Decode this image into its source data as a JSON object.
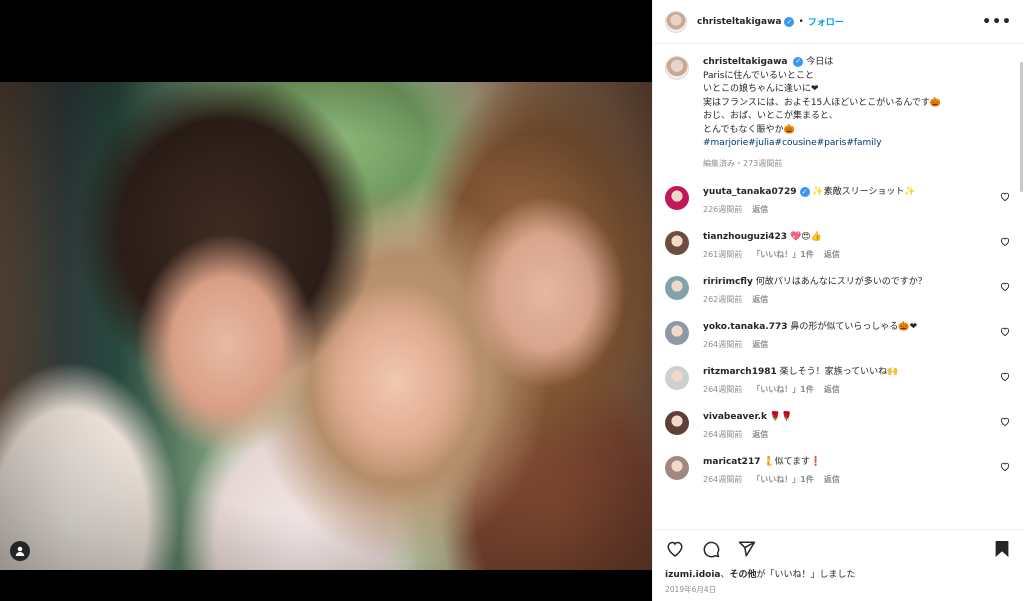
{
  "header": {
    "username": "christeltakigawa",
    "separator": "•",
    "follow_label": "フォロー",
    "more_label": "•••"
  },
  "caption": {
    "username": "christeltakigawa",
    "lines": [
      "今日は",
      "Parisに住んでいるいとこと",
      "いとこの娘ちゃんに逢いに❤",
      "実はフランスには、およそ15人ほどいとこがいるんです🎃",
      "おじ、おば、いとこが集まると、",
      "とんでもなく賑やか🎃"
    ],
    "hashtags": "#marjorie#julia#cousine#paris#family",
    "meta": "編集済み・273週間前"
  },
  "comments": [
    {
      "user": "yuuta_tanaka0729",
      "verified": true,
      "text": "✨素敵スリーショット✨",
      "time": "226週間前",
      "likes": "",
      "reply": "返信",
      "avatar_color": "#c2185b"
    },
    {
      "user": "tianzhouguzi423",
      "verified": false,
      "text": "💖😍👍",
      "time": "261週間前",
      "likes": "「いいね！」1件",
      "reply": "返信",
      "avatar_color": "#6d4c41"
    },
    {
      "user": "riririmcfly",
      "verified": false,
      "text": "何故パリはあんなにスリが多いのですか？",
      "time": "262週間前",
      "likes": "",
      "reply": "返信",
      "avatar_color": "#7fa3a8"
    },
    {
      "user": "yoko.tanaka.773",
      "verified": false,
      "text": "鼻の形が似ていらっしゃる🎃❤",
      "time": "264週間前",
      "likes": "",
      "reply": "返信",
      "avatar_color": "#8d9aa5"
    },
    {
      "user": "ritzmarch1981",
      "verified": false,
      "text": "楽しそう！家族っていいね🙌",
      "time": "264週間前",
      "likes": "「いいね！」1件",
      "reply": "返信",
      "avatar_color": "#cfcfcf"
    },
    {
      "user": "vivabeaver.k",
      "verified": false,
      "text": "🌹🌹",
      "time": "264週間前",
      "likes": "",
      "reply": "返信",
      "avatar_color": "#5d4037"
    },
    {
      "user": "maricat217",
      "verified": false,
      "text": "🧜似てます❗",
      "time": "264週間前",
      "likes": "「いいね！」1件",
      "reply": "返信",
      "avatar_color": "#a1887f"
    }
  ],
  "likes_line": {
    "user": "izumi.idoia",
    "middle": "、",
    "others": "その他",
    "suffix": "が「いいね！」しました"
  },
  "post_date": "2019年6月4日"
}
